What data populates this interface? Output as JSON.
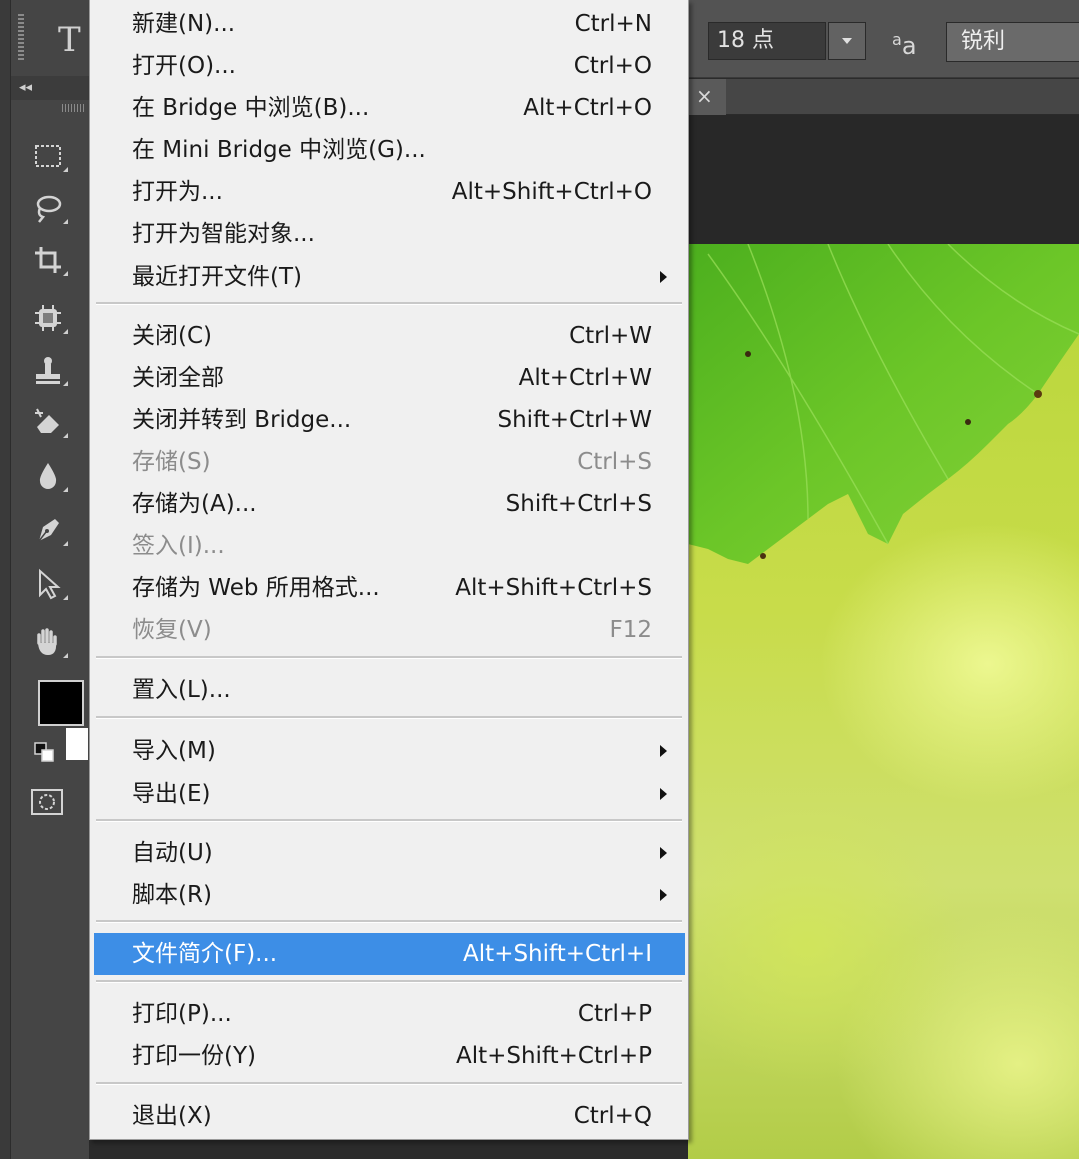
{
  "options_bar": {
    "text_tool_glyph": "T",
    "font_size": "18 点",
    "aa_glyph_small": "a",
    "aa_glyph_big": "a",
    "antialias": "锐利"
  },
  "toolbar": {
    "collapse_glyph": "◂◂"
  },
  "tab": {
    "close_glyph": "×"
  },
  "colors": {
    "menu_highlight": "#3d8ee6",
    "foreground": "#000000",
    "background": "#ffffff"
  },
  "menu": {
    "items": [
      {
        "label": "新建(N)...",
        "shortcut": "Ctrl+N"
      },
      {
        "label": "打开(O)...",
        "shortcut": "Ctrl+O"
      },
      {
        "label": "在 Bridge 中浏览(B)...",
        "shortcut": "Alt+Ctrl+O"
      },
      {
        "label": "在 Mini Bridge 中浏览(G)...",
        "shortcut": ""
      },
      {
        "label": "打开为...",
        "shortcut": "Alt+Shift+Ctrl+O"
      },
      {
        "label": "打开为智能对象...",
        "shortcut": ""
      },
      {
        "label": "最近打开文件(T)",
        "shortcut": ""
      },
      {
        "label": "关闭(C)",
        "shortcut": "Ctrl+W"
      },
      {
        "label": "关闭全部",
        "shortcut": "Alt+Ctrl+W"
      },
      {
        "label": "关闭并转到 Bridge...",
        "shortcut": "Shift+Ctrl+W"
      },
      {
        "label": "存储(S)",
        "shortcut": "Ctrl+S"
      },
      {
        "label": "存储为(A)...",
        "shortcut": "Shift+Ctrl+S"
      },
      {
        "label": "签入(I)...",
        "shortcut": ""
      },
      {
        "label": "存储为 Web 所用格式...",
        "shortcut": "Alt+Shift+Ctrl+S"
      },
      {
        "label": "恢复(V)",
        "shortcut": "F12"
      },
      {
        "label": "置入(L)...",
        "shortcut": ""
      },
      {
        "label": "导入(M)",
        "shortcut": ""
      },
      {
        "label": "导出(E)",
        "shortcut": ""
      },
      {
        "label": "自动(U)",
        "shortcut": ""
      },
      {
        "label": "脚本(R)",
        "shortcut": ""
      },
      {
        "label": "文件简介(F)...",
        "shortcut": "Alt+Shift+Ctrl+I"
      },
      {
        "label": "打印(P)...",
        "shortcut": "Ctrl+P"
      },
      {
        "label": "打印一份(Y)",
        "shortcut": "Alt+Shift+Ctrl+P"
      },
      {
        "label": "退出(X)",
        "shortcut": "Ctrl+Q"
      }
    ]
  }
}
